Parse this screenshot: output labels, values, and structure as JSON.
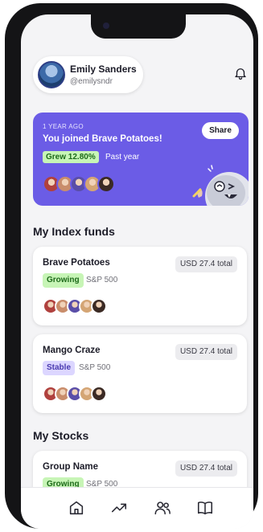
{
  "profile": {
    "name": "Emily Sanders",
    "handle": "@emilysndr"
  },
  "banner": {
    "time_ago": "1 YEAR AGO",
    "headline": "You joined Brave Potatoes!",
    "growth": "Grew 12.80%",
    "period": "Past year",
    "share_label": "Share"
  },
  "index_funds": {
    "title": "My Index funds",
    "items": [
      {
        "name": "Brave Potatoes",
        "tag": "Growing",
        "index": "S&P 500",
        "total": "USD 27.4 total"
      },
      {
        "name": "Mango Craze",
        "tag": "Stable",
        "index": "S&P 500",
        "total": "USD 27.4 total"
      }
    ]
  },
  "stocks": {
    "title": "My Stocks",
    "items": [
      {
        "name": "Group Name",
        "tag": "Growing",
        "index": "S&P 500",
        "total": "USD 27.4 total"
      }
    ]
  },
  "member_colors": [
    "#b0413e",
    "#c98d6b",
    "#5a4ea8",
    "#d4a574",
    "#3b2a24"
  ],
  "tabs": [
    "home-icon",
    "trending-icon",
    "users-icon",
    "book-icon"
  ],
  "colors": {
    "accent": "#6b5ce6",
    "growing_bg": "#c7f5b6",
    "stable_bg": "#dcd6ff"
  }
}
